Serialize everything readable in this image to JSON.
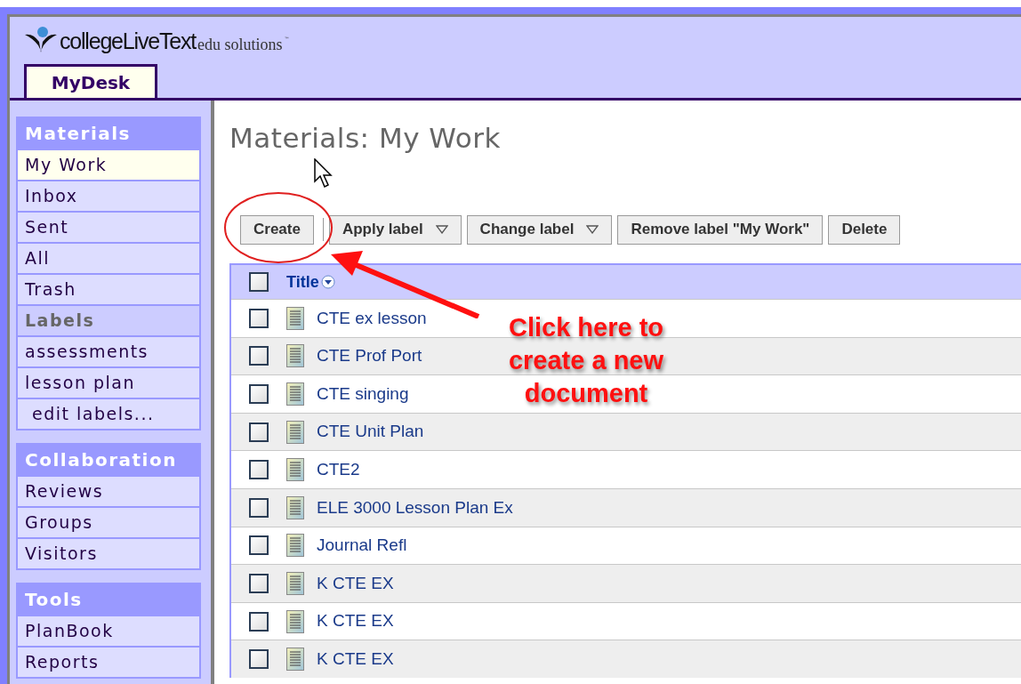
{
  "logo": {
    "brand": "collegeLiveText",
    "tagline": "edu solutions",
    "mark": "™"
  },
  "tabs": [
    {
      "label": "MyDesk",
      "selected": true
    }
  ],
  "sidebar": [
    {
      "heading": "Materials",
      "items": [
        {
          "label": "My Work",
          "kind": "item",
          "selected": true
        },
        {
          "label": "Inbox",
          "kind": "item",
          "selected": false
        },
        {
          "label": "Sent",
          "kind": "item",
          "selected": false
        },
        {
          "label": "All",
          "kind": "item",
          "selected": false
        },
        {
          "label": "Trash",
          "kind": "item",
          "selected": false
        },
        {
          "label": "Labels",
          "kind": "subheading",
          "selected": false
        },
        {
          "label": "assessments",
          "kind": "item",
          "selected": false
        },
        {
          "label": "lesson plan",
          "kind": "item",
          "selected": false
        },
        {
          "label": "edit labels...",
          "kind": "action",
          "selected": false
        }
      ]
    },
    {
      "heading": "Collaboration",
      "items": [
        {
          "label": "Reviews",
          "kind": "item",
          "selected": false
        },
        {
          "label": "Groups",
          "kind": "item",
          "selected": false
        },
        {
          "label": "Visitors",
          "kind": "item",
          "selected": false
        }
      ]
    },
    {
      "heading": "Tools",
      "items": [
        {
          "label": "PlanBook",
          "kind": "item",
          "selected": false
        },
        {
          "label": "Reports",
          "kind": "item",
          "selected": false
        }
      ]
    }
  ],
  "page_title": "Materials: My Work",
  "toolbar": [
    {
      "label": "Create",
      "kind": "button"
    },
    {
      "label": "Apply label",
      "kind": "dropdown"
    },
    {
      "label": "Change label",
      "kind": "dropdown"
    },
    {
      "label": "Remove label \"My Work\"",
      "kind": "button"
    },
    {
      "label": "Delete",
      "kind": "button"
    }
  ],
  "table": {
    "column": "Title",
    "all_checked": false,
    "rows": [
      {
        "title": "CTE ex lesson",
        "checked": false
      },
      {
        "title": "CTE Prof Port",
        "checked": false
      },
      {
        "title": "CTE singing",
        "checked": false
      },
      {
        "title": "CTE Unit Plan",
        "checked": false
      },
      {
        "title": "CTE2",
        "checked": false
      },
      {
        "title": "ELE 3000 Lesson Plan Ex",
        "checked": false
      },
      {
        "title": "Journal Refl",
        "checked": false
      },
      {
        "title": "K CTE EX",
        "checked": false
      },
      {
        "title": "K CTE EX",
        "checked": false
      },
      {
        "title": "K CTE EX",
        "checked": false
      }
    ]
  },
  "annotation": {
    "text": "Click here to create a new document"
  }
}
